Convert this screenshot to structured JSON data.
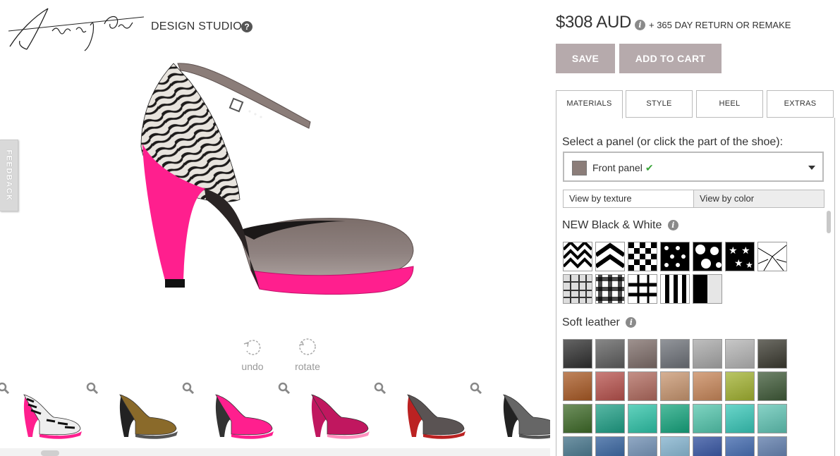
{
  "brand": {
    "logo_text": "Shoes of Prey",
    "studio_label": "DESIGN STUDIO",
    "help_icon": "question-circle-icon"
  },
  "feedback": {
    "label": "FEEDBACK"
  },
  "tools": {
    "undo_label": "undo",
    "rotate_label": "rotate"
  },
  "carousel": {
    "designs": [
      {
        "name": "zebra-pink-pump"
      },
      {
        "name": "tan-lace-up-bootie"
      },
      {
        "name": "pink-polka-dot-heel"
      },
      {
        "name": "magenta-lace-ankle-strap"
      },
      {
        "name": "grey-t-bar-pump"
      },
      {
        "name": "grey-mary-jane"
      }
    ],
    "scroll_position": 0.08
  },
  "price": {
    "amount": "$308 AUD",
    "return_policy": "+ 365 DAY RETURN OR REMAKE"
  },
  "actions": {
    "save_label": "SAVE",
    "add_to_cart_label": "ADD TO CART"
  },
  "tabs": [
    {
      "label": "MATERIALS",
      "active": true
    },
    {
      "label": "STYLE",
      "active": false
    },
    {
      "label": "HEEL",
      "active": false
    },
    {
      "label": "EXTRAS",
      "active": false
    }
  ],
  "panel": {
    "select_label": "Select a panel (or click the part of the shoe):",
    "selected_panel": "Front panel",
    "selected_swatch_color": "#8b7d79",
    "view_by_texture": "View by texture",
    "view_by_color": "View by color"
  },
  "sections": [
    {
      "title": "NEW Black & White",
      "swatches": [
        "chevron",
        "chevron-wide",
        "houndstooth",
        "polka-small",
        "polka-large",
        "stars",
        "cracked-lines",
        "plaid-fine",
        "gingham",
        "plaid-bold",
        "stripes-wide",
        "stripe-block"
      ]
    },
    {
      "title": "Soft leather",
      "swatches": [
        "#2f2f2f",
        "#5e5e5e",
        "#7d6c68",
        "#6d7178",
        "#a8a8a8",
        "#b4b4b4",
        "#3b3a30",
        "#a95a25",
        "#b7524d",
        "#b06a5e",
        "#c89670",
        "#c8875a",
        "#a2b231",
        "#3f5a38",
        "#3e6a28",
        "#1f9f86",
        "#2ec3a8",
        "#16a57e",
        "#53c6ad",
        "#38c7b8",
        "#60c4b4",
        "#3f6f86",
        "#2f5d9a",
        "#6b8bb0",
        "#7fb0cc",
        "#2c4c9c",
        "#3a63aa",
        "#5a78a8"
      ]
    }
  ],
  "colors": {
    "button": "#b6aaac",
    "accent_pink": "#ff1f8e",
    "upper_taupe": "#8b7d79"
  }
}
